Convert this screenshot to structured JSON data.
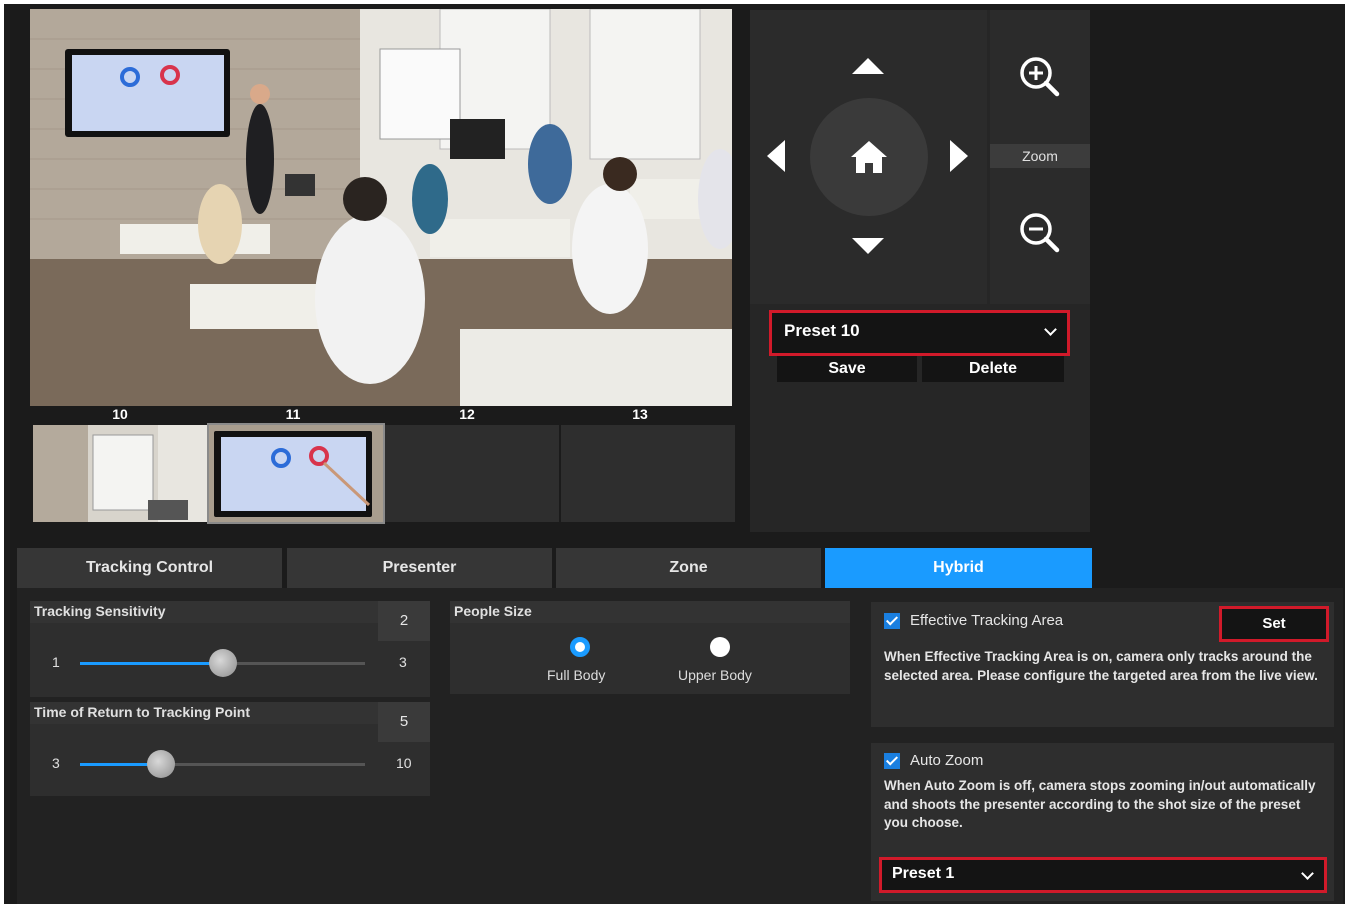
{
  "live_view": {
    "preset_numbers": [
      "10",
      "11",
      "12",
      "13"
    ]
  },
  "ptz": {
    "zoom_label": "Zoom",
    "preset_selected": "Preset 10",
    "save_label": "Save",
    "delete_label": "Delete"
  },
  "tabs": [
    {
      "label": "Tracking Control",
      "active": false
    },
    {
      "label": "Presenter",
      "active": false
    },
    {
      "label": "Zone",
      "active": false
    },
    {
      "label": "Hybrid",
      "active": true
    }
  ],
  "tracking_sensitivity": {
    "label": "Tracking Sensitivity",
    "value": "2",
    "min": "1",
    "max": "3",
    "level": 2
  },
  "return_time": {
    "label": "Time of Return to Tracking Point",
    "value": "5",
    "min": "3",
    "max": "10",
    "level": 5
  },
  "people_size": {
    "label": "People Size",
    "options": [
      {
        "label": "Full Body",
        "checked": true
      },
      {
        "label": "Upper Body",
        "checked": false
      }
    ]
  },
  "effective_tracking_area": {
    "label": "Effective Tracking Area",
    "checked": true,
    "set_label": "Set",
    "description": "When Effective Tracking Area is on, camera only tracks around the selected area. Please configure the targeted area from the live view."
  },
  "auto_zoom": {
    "label": "Auto Zoom",
    "checked": true,
    "description": "When Auto Zoom is off, camera stops zooming in/out automatically and shoots the presenter according to the shot size of the preset you choose.",
    "preset_selected": "Preset 1"
  },
  "colors": {
    "accent": "#1a9bff",
    "highlight": "#d11a2a",
    "panel": "#2e2e2e",
    "background": "#1b1b1b"
  },
  "icons": [
    "home-icon",
    "zoom-in-icon",
    "zoom-out-icon",
    "arrow-up-icon",
    "arrow-down-icon",
    "arrow-left-icon",
    "arrow-right-icon",
    "chevron-down-icon",
    "checkbox-checked-icon"
  ]
}
